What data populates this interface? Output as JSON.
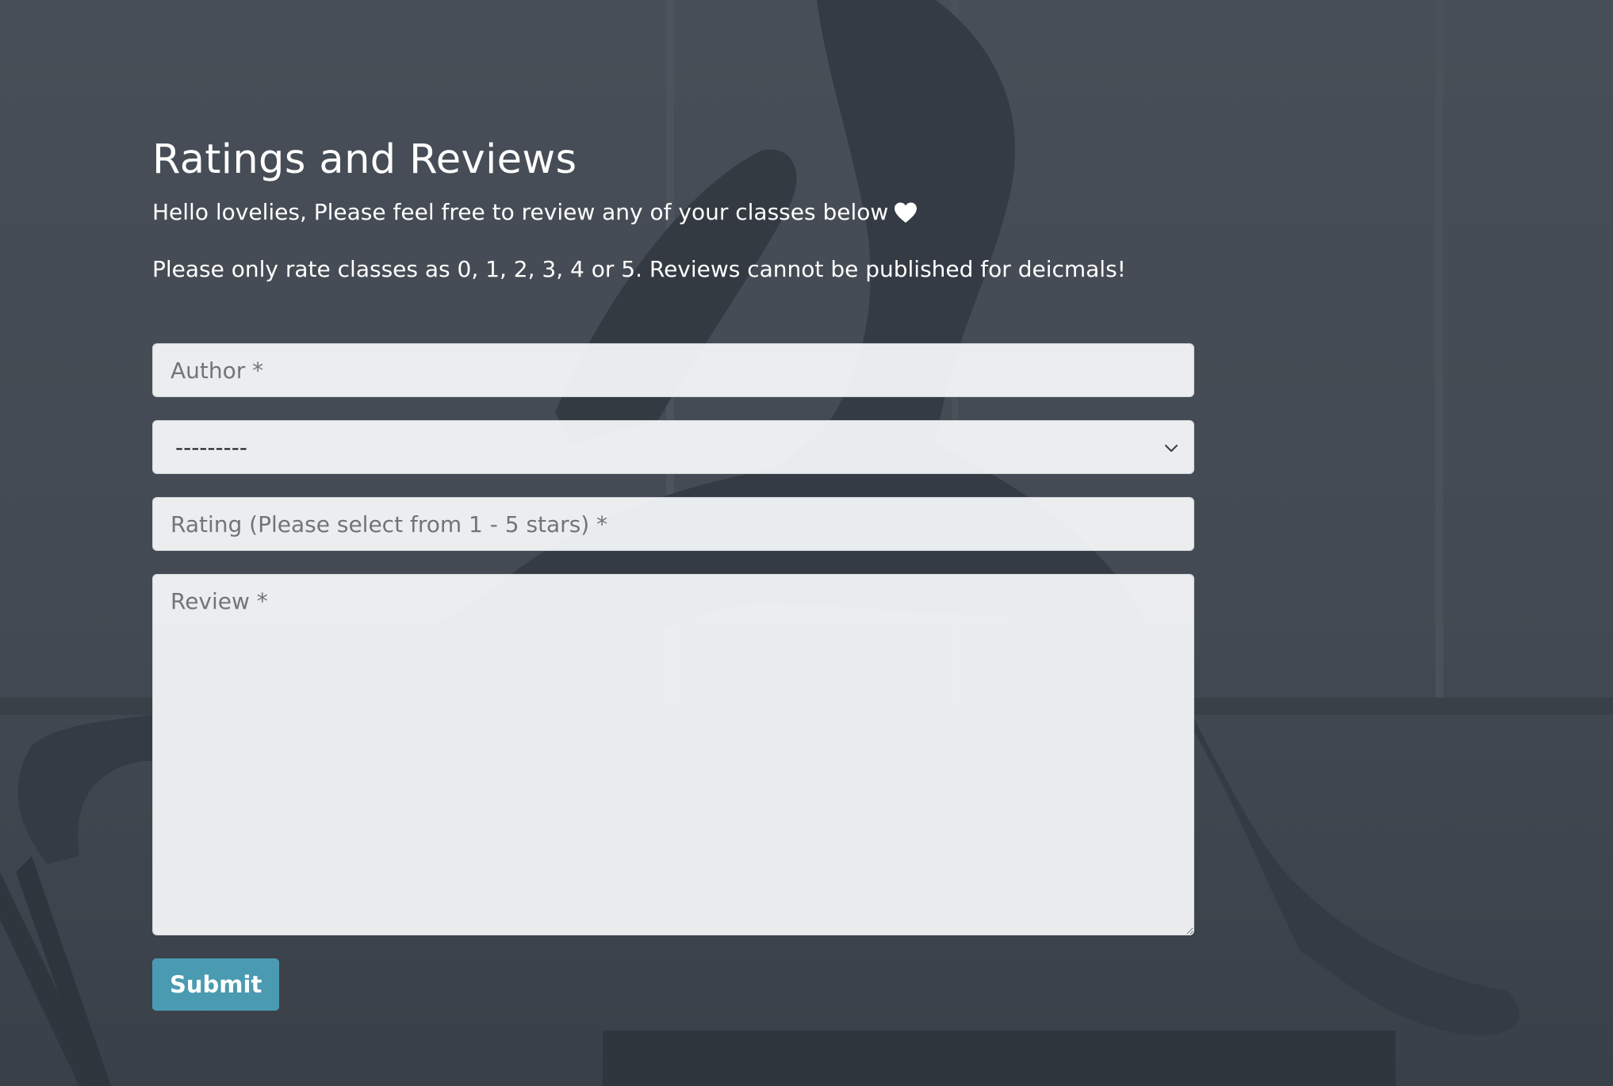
{
  "page": {
    "background_color": "#3f4650",
    "accent_color": "#4a9bb1"
  },
  "header": {
    "title": "Ratings and Reviews",
    "intro": "Hello lovelies, Please feel free to review any of your classes below",
    "intro_icon": "heart-icon",
    "notice": "Please only rate classes as 0, 1, 2, 3, 4 or 5. Reviews cannot be published for deicmals!"
  },
  "form": {
    "author_placeholder": "Author *",
    "class_select": {
      "selected": "---------",
      "options": [
        "---------"
      ]
    },
    "rating_placeholder": "Rating (Please select from 1 - 5 stars) *",
    "review_placeholder": "Review *",
    "submit_label": "Submit"
  }
}
